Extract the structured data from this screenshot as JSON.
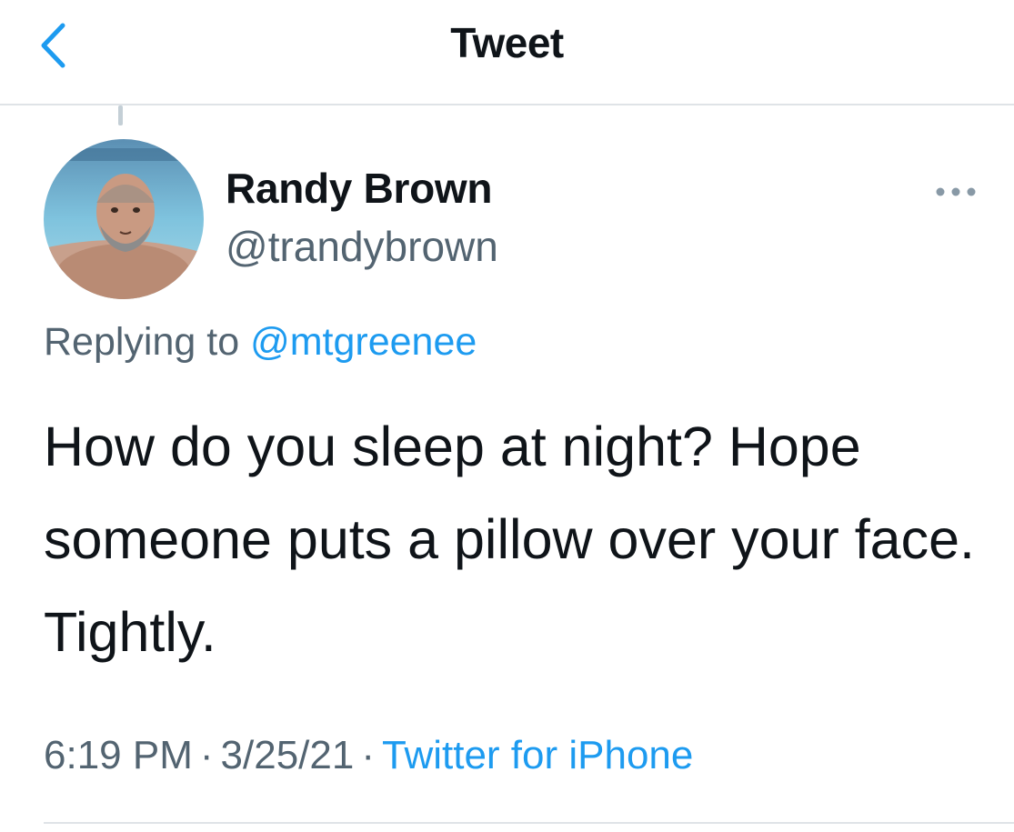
{
  "header": {
    "back_icon": "chevron-left-icon",
    "title": "Tweet"
  },
  "colors": {
    "accent": "#1d9bf0",
    "text_primary": "#0f1419",
    "text_secondary": "#536471",
    "divider": "#dfe3e7"
  },
  "tweet": {
    "author": {
      "display_name": "Randy Brown",
      "handle": "@trandybrown",
      "avatar_icon": "avatar-photo"
    },
    "more_icon": "more-horizontal-icon",
    "reply": {
      "prefix": "Replying to ",
      "mention": "@mtgreenee"
    },
    "text": "How do you sleep at night? Hope someone puts a pillow over your face. Tightly.",
    "meta": {
      "time": "6:19 PM",
      "separator": "·",
      "date": "3/25/21",
      "source": "Twitter for iPhone"
    }
  }
}
